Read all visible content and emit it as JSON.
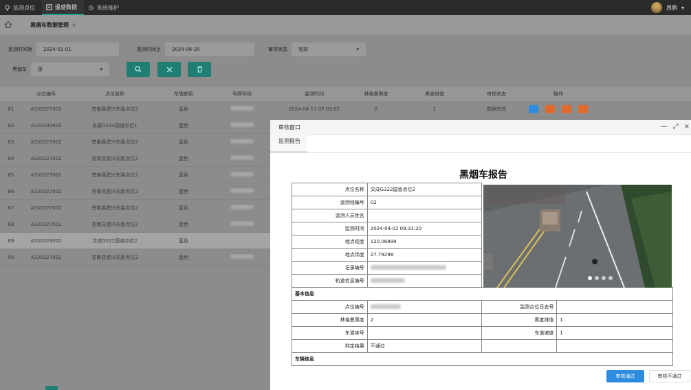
{
  "topnav": {
    "items": [
      {
        "label": "监测点位",
        "active": false,
        "icon": "location-icon"
      },
      {
        "label": "遥感数据",
        "active": true,
        "icon": "data-icon"
      },
      {
        "label": "系统维护",
        "active": false,
        "icon": "gear-icon"
      }
    ],
    "user": "周鹏"
  },
  "breadcrumb": {
    "title": "黑烟车数据管理"
  },
  "filters": {
    "start_label": "监测时间始",
    "start_value": "2024-01-01",
    "end_label": "监测时间止",
    "end_value": "2024-06-30",
    "status_label": "审核状态",
    "status_value": "有效",
    "smoke_label": "黑烟车",
    "smoke_value": "是"
  },
  "table": {
    "headers": [
      "点位编号",
      "点位名称",
      "车牌颜色",
      "号牌号码",
      "监测时间",
      "林格曼黑度",
      "黑度排值",
      "审核状态",
      "操作"
    ],
    "rows": [
      {
        "idx": "81",
        "code": "A330327002",
        "name": "苍南县建兴东路点位2",
        "color": "蓝色",
        "time": "2024-04-11 07:03:02",
        "lg": "2",
        "bv": "1",
        "status": "数据有效"
      },
      {
        "idx": "82",
        "code": "A330300000",
        "name": "永嘉G104国道点位1",
        "color": "蓝色",
        "time": "",
        "lg": "",
        "bv": "",
        "status": ""
      },
      {
        "idx": "83",
        "code": "A330327002",
        "name": "苍南县建兴东路点位2",
        "color": "蓝色",
        "time": "",
        "lg": "",
        "bv": "",
        "status": ""
      },
      {
        "idx": "84",
        "code": "A330327002",
        "name": "苍南县建兴东路点位2",
        "color": "蓝色",
        "time": "",
        "lg": "",
        "bv": "",
        "status": ""
      },
      {
        "idx": "85",
        "code": "A330327002",
        "name": "苍南县建兴东路点位2",
        "color": "蓝色",
        "time": "",
        "lg": "",
        "bv": "",
        "status": ""
      },
      {
        "idx": "86",
        "code": "A330327002",
        "name": "苍南县建兴东路点位2",
        "color": "蓝色",
        "time": "",
        "lg": "",
        "bv": "",
        "status": ""
      },
      {
        "idx": "87",
        "code": "A330327002",
        "name": "苍南县建兴东路点位2",
        "color": "蓝色",
        "time": "",
        "lg": "",
        "bv": "",
        "status": ""
      },
      {
        "idx": "88",
        "code": "A330327002",
        "name": "苍南县建兴东路点位2",
        "color": "蓝色",
        "time": "",
        "lg": "",
        "bv": "",
        "status": ""
      },
      {
        "idx": "89",
        "code": "A330329002",
        "name": "文成G322国道点位2",
        "color": "蓝色",
        "time": "",
        "lg": "",
        "bv": "",
        "status": ""
      },
      {
        "idx": "90",
        "code": "A330327002",
        "name": "苍南县建兴东路点位2",
        "color": "蓝色",
        "time": "",
        "lg": "",
        "bv": "",
        "status": ""
      }
    ]
  },
  "modal": {
    "title": "审核窗口",
    "tab": "监测报告",
    "report_title": "黑烟车报告",
    "fields": {
      "point_name_label": "点位名称",
      "point_name": "文成G322国道点位2",
      "remote_code_label": "遥测线编号",
      "remote_code": "02",
      "inspector_label": "监测人员姓名",
      "inspector": "",
      "time_label": "监测时间",
      "time": "2024-04-02 09:31:20",
      "lng_label": "地点经度",
      "lng": "120.06899",
      "lat_label": "地点纬度",
      "lat": "27.79298",
      "record_label": "记录编号",
      "track_label": "轨迹信息编号",
      "basic_section": "基本信息",
      "point_code_label": "点位编号",
      "point_reg_label": "监测点位日志号",
      "point_reg": "",
      "lg_label": "林格曼黑度",
      "lg": "2",
      "bv_label": "黑度排值",
      "bv": "1",
      "lane_seq_label": "车道序号",
      "lane_seq": "",
      "lane_dir_label": "车道坡度",
      "lane_dir": "1",
      "result_label": "判定结果",
      "result": "不通过",
      "vehicle_section": "车辆信息"
    },
    "pass_label": "审核通过",
    "fail_label": "审核不通过"
  },
  "colors": {
    "accent": "#1f7f72",
    "primary": "#2d8ce0",
    "op_blue": "#2d8ce0",
    "op_orange": "#e06a2c"
  }
}
